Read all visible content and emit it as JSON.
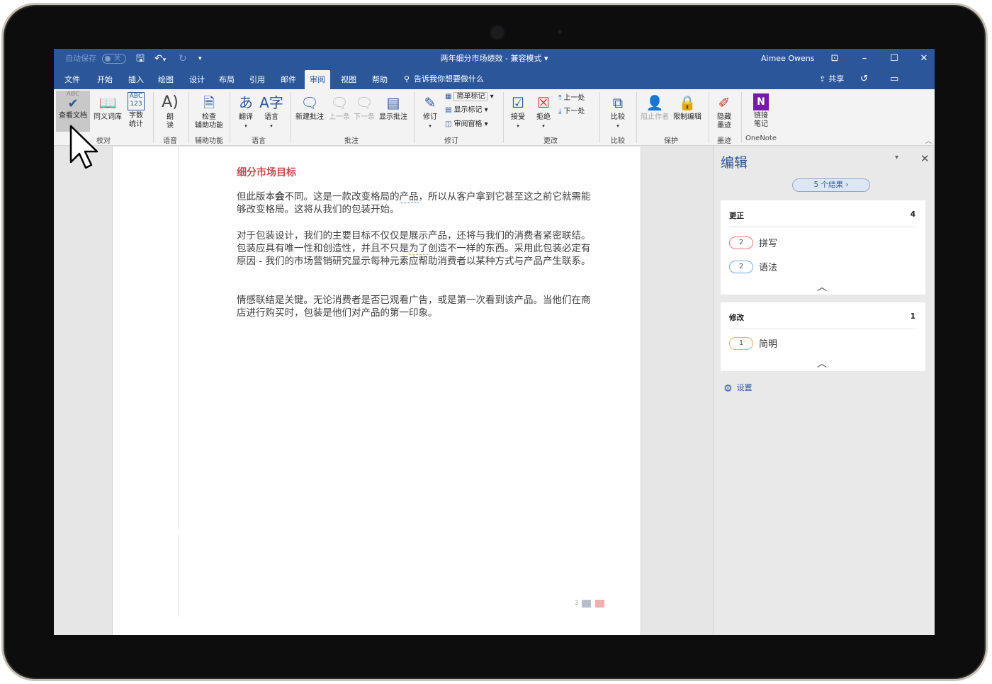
{
  "titlebar": {
    "autosave_label": "自动保存",
    "autosave_state": "关",
    "document_title": "两年细分市场绩效 - 兼容模式 ▾",
    "user_name": "Aimee Owens"
  },
  "tabs": [
    "文件",
    "开始",
    "插入",
    "绘图",
    "设计",
    "布局",
    "引用",
    "邮件",
    "审阅",
    "视图",
    "帮助"
  ],
  "active_tab": "审阅",
  "tell_me": "告诉我你想要做什么",
  "share_label": "共享",
  "ribbon": {
    "proofing": {
      "label": "校对",
      "review_doc": "查看文档",
      "thesaurus": "同义词库",
      "word_count": [
        "字数",
        "统计"
      ],
      "abc": "ABC",
      "abc123": "ABC\n123"
    },
    "speech": {
      "label": "语音",
      "read_aloud": [
        "朗",
        "读"
      ]
    },
    "accessibility": {
      "label": "辅助功能",
      "check": [
        "检查",
        "辅助功能"
      ]
    },
    "language": {
      "label": "语言",
      "translate": "翻译",
      "language": "语言"
    },
    "comments": {
      "label": "批注",
      "new_comment": "新建批注",
      "previous": "上一条",
      "next": "下一条",
      "show_comments": "显示批注"
    },
    "tracking": {
      "label": "修订",
      "track_changes": "修订",
      "simple_markup": "简单标记",
      "show_markup": "显示标记",
      "review_pane": "审阅窗格"
    },
    "changes": {
      "label": "更改",
      "accept": "接受",
      "reject": "拒绝",
      "previous": "上一处",
      "next": "下一处"
    },
    "compare": {
      "label": "比较",
      "compare": "比较"
    },
    "protect": {
      "label": "保护",
      "block_authors": "阻止作者",
      "restrict_editing": "限制编辑"
    },
    "ink": {
      "label": "墨迹",
      "hide_ink": [
        "隐藏",
        "墨迹"
      ]
    },
    "onenote": {
      "label": "OneNote",
      "linked_notes": [
        "链接",
        "笔记"
      ]
    }
  },
  "document": {
    "heading": "细分市场目标",
    "p1": {
      "a": "但此版本",
      "b": "会",
      "c": "不同。这是一款改变格局的",
      "d": "产品",
      "e": "，所以从客户拿到它甚至这之前它就需能够改变格局。这将从我们的包装开始。"
    },
    "p2": {
      "a": "对于包装设计，我们的主要目标不仅仅是展示产品，还将与我们的消费者紧密联结。包装应具有唯一性和创造性，并且不只是",
      "b": "为了",
      "c": "创造不一样的东西。采用此包装必定有原因 - 我们的市场营销研究显示每种元素应帮助消费者以某种方式与产品产生联系。"
    },
    "p3": "情感联结是关键。无论消费者是否已观看广告，或是第一次看到该产品。当他们在商店进行购买时，包装是他们对产品的第一印象。",
    "page_number": "3"
  },
  "editor_pane": {
    "title": "编辑",
    "results": "5 个结果 ›",
    "corrections": {
      "title": "更正",
      "count": "4",
      "items": [
        {
          "count": "2",
          "label": "拼写"
        },
        {
          "count": "2",
          "label": "语法"
        }
      ]
    },
    "refinements": {
      "title": "修改",
      "count": "1",
      "items": [
        {
          "count": "1",
          "label": "简明"
        }
      ]
    },
    "settings": "设置"
  },
  "colors": {
    "brand": "#2b579a",
    "heading": "#c0504d",
    "spelling": "#e57a7a",
    "grammar": "#7aa3e0",
    "refinement": "#d7b36a"
  }
}
